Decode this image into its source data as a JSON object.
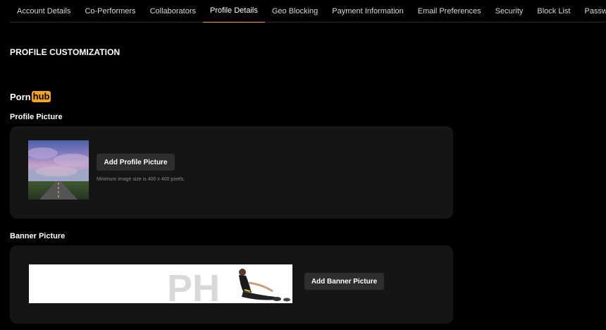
{
  "tabs": [
    {
      "label": "Account Details"
    },
    {
      "label": "Co-Performers"
    },
    {
      "label": "Collaborators"
    },
    {
      "label": "Profile Details",
      "active": true
    },
    {
      "label": "Geo Blocking"
    },
    {
      "label": "Payment Information"
    },
    {
      "label": "Email Preferences"
    },
    {
      "label": "Security"
    },
    {
      "label": "Block List"
    },
    {
      "label": "Passwords"
    }
  ],
  "page": {
    "title": "PROFILE CUSTOMIZATION"
  },
  "logo": {
    "part1": "Porn",
    "part2": "hub",
    "accent": "#f7a41d"
  },
  "profile": {
    "label": "Profile Picture",
    "button": "Add Profile Picture",
    "hint": "Minimum image size is 400 x 400 pixels."
  },
  "banner": {
    "label": "Banner Picture",
    "button": "Add Banner Picture",
    "watermark": "PH"
  }
}
